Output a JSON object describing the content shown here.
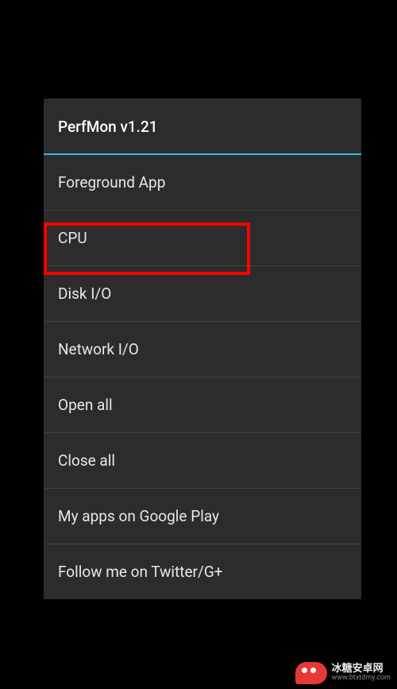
{
  "dialog": {
    "title": "PerfMon v1.21",
    "items": [
      {
        "label": "Foreground App"
      },
      {
        "label": "CPU"
      },
      {
        "label": "Disk I/O"
      },
      {
        "label": "Network I/O"
      },
      {
        "label": "Open all"
      },
      {
        "label": "Close all"
      },
      {
        "label": "My apps on Google Play"
      },
      {
        "label": "Follow me on Twitter/G+"
      }
    ]
  },
  "highlight": {
    "target_index": 1
  },
  "watermark": {
    "cn": "冰糖安卓网",
    "url": "www.btxtdmy.com"
  }
}
